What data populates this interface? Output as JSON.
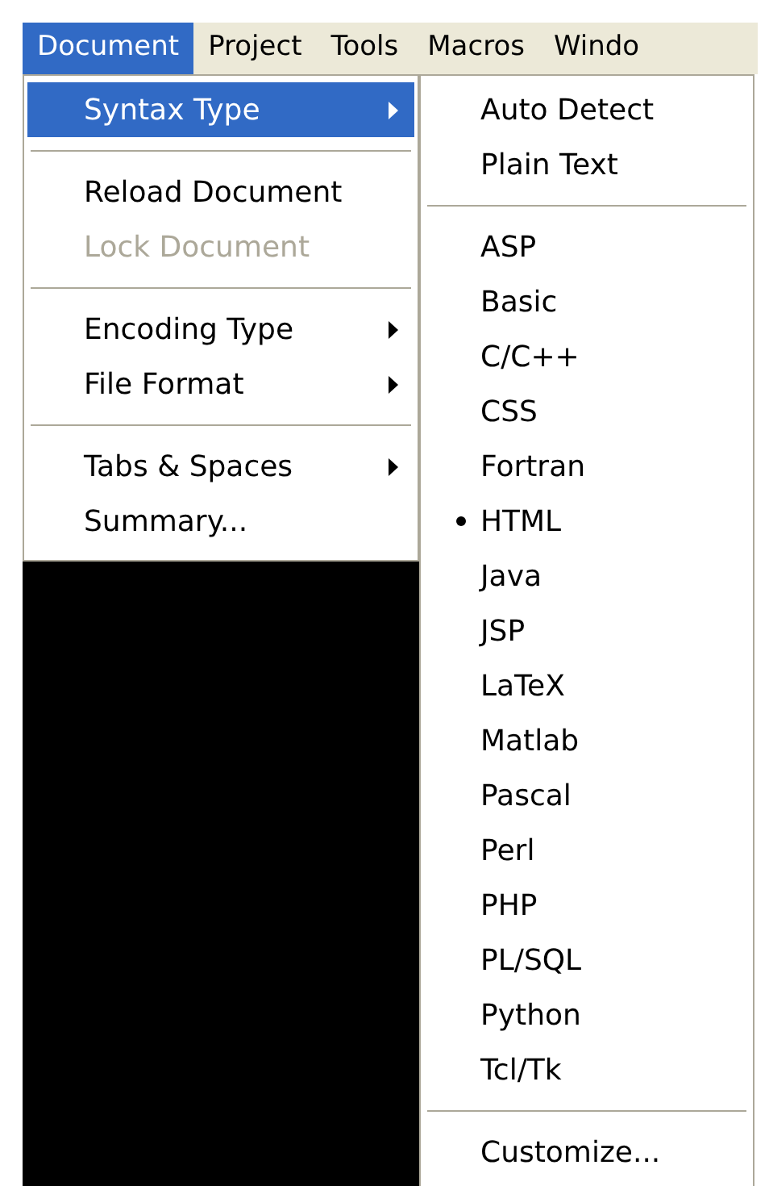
{
  "menubar": [
    {
      "label": "Document",
      "selected": true
    },
    {
      "label": "Project",
      "selected": false
    },
    {
      "label": "Tools",
      "selected": false
    },
    {
      "label": "Macros",
      "selected": false
    },
    {
      "label": "Windo",
      "selected": false
    }
  ],
  "menu": [
    {
      "kind": "item",
      "label": "Syntax Type",
      "selected": true,
      "disabled": false,
      "submenu": true
    },
    {
      "kind": "separator"
    },
    {
      "kind": "item",
      "label": "Reload Document",
      "selected": false,
      "disabled": false,
      "submenu": false
    },
    {
      "kind": "item",
      "label": "Lock Document",
      "selected": false,
      "disabled": true,
      "submenu": false
    },
    {
      "kind": "separator"
    },
    {
      "kind": "item",
      "label": "Encoding Type",
      "selected": false,
      "disabled": false,
      "submenu": true
    },
    {
      "kind": "item",
      "label": "File Format",
      "selected": false,
      "disabled": false,
      "submenu": true
    },
    {
      "kind": "separator"
    },
    {
      "kind": "item",
      "label": "Tabs & Spaces",
      "selected": false,
      "disabled": false,
      "submenu": true
    },
    {
      "kind": "item",
      "label": "Summary...",
      "selected": false,
      "disabled": false,
      "submenu": false
    }
  ],
  "submenu": [
    {
      "kind": "item",
      "label": "Auto Detect",
      "checked": false
    },
    {
      "kind": "item",
      "label": "Plain Text",
      "checked": false
    },
    {
      "kind": "separator"
    },
    {
      "kind": "item",
      "label": "ASP",
      "checked": false
    },
    {
      "kind": "item",
      "label": "Basic",
      "checked": false
    },
    {
      "kind": "item",
      "label": "C/C++",
      "checked": false
    },
    {
      "kind": "item",
      "label": "CSS",
      "checked": false
    },
    {
      "kind": "item",
      "label": "Fortran",
      "checked": false
    },
    {
      "kind": "item",
      "label": "HTML",
      "checked": true
    },
    {
      "kind": "item",
      "label": "Java",
      "checked": false
    },
    {
      "kind": "item",
      "label": "JSP",
      "checked": false
    },
    {
      "kind": "item",
      "label": "LaTeX",
      "checked": false
    },
    {
      "kind": "item",
      "label": "Matlab",
      "checked": false
    },
    {
      "kind": "item",
      "label": "Pascal",
      "checked": false
    },
    {
      "kind": "item",
      "label": "Perl",
      "checked": false
    },
    {
      "kind": "item",
      "label": "PHP",
      "checked": false
    },
    {
      "kind": "item",
      "label": "PL/SQL",
      "checked": false
    },
    {
      "kind": "item",
      "label": "Python",
      "checked": false
    },
    {
      "kind": "item",
      "label": "Tcl/Tk",
      "checked": false
    },
    {
      "kind": "separator"
    },
    {
      "kind": "item",
      "label": "Customize...",
      "checked": false
    }
  ]
}
